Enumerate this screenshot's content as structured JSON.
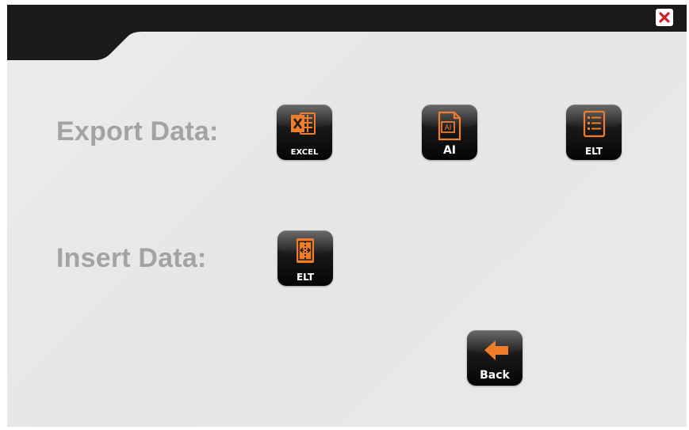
{
  "window": {
    "close_icon": "close-icon",
    "accent_color": "#f07d2c",
    "close_color": "#d0202e",
    "header_color": "#1a1a1a"
  },
  "export": {
    "label": "Export Data:",
    "buttons": [
      {
        "caption": "EXCEL",
        "icon": "excel-icon"
      },
      {
        "caption": "AI",
        "icon": "ai-file-icon"
      },
      {
        "caption": "ELT",
        "icon": "list-document-icon"
      }
    ]
  },
  "insert": {
    "label": "Insert Data:",
    "buttons": [
      {
        "caption": "ELT",
        "icon": "column-insert-icon"
      }
    ]
  },
  "back": {
    "caption": "Back",
    "icon": "arrow-left-icon"
  }
}
